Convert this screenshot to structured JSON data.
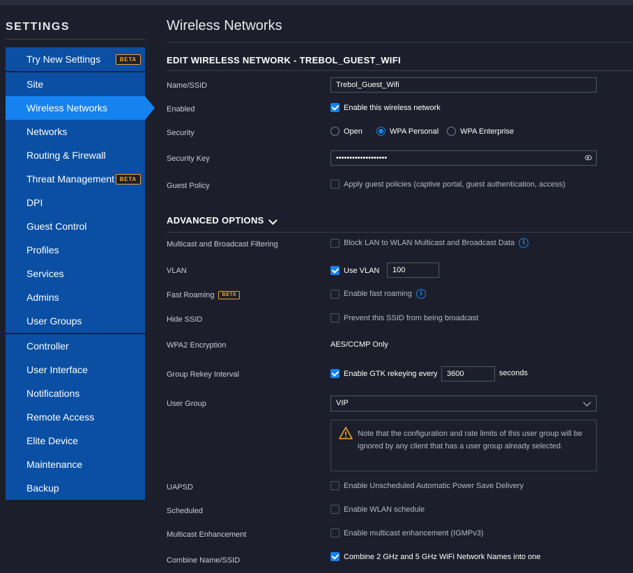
{
  "sidebar": {
    "title": "SETTINGS",
    "beta_label": "BETA",
    "items": [
      {
        "label": "Try New Settings"
      },
      {
        "label": "Site"
      },
      {
        "label": "Wireless Networks"
      },
      {
        "label": "Networks"
      },
      {
        "label": "Routing & Firewall"
      },
      {
        "label": "Threat Management"
      },
      {
        "label": "DPI"
      },
      {
        "label": "Guest Control"
      },
      {
        "label": "Profiles"
      },
      {
        "label": "Services"
      },
      {
        "label": "Admins"
      },
      {
        "label": "User Groups"
      },
      {
        "label": "Controller"
      },
      {
        "label": "User Interface"
      },
      {
        "label": "Notifications"
      },
      {
        "label": "Remote Access"
      },
      {
        "label": "Elite Device"
      },
      {
        "label": "Maintenance"
      },
      {
        "label": "Backup"
      }
    ]
  },
  "main": {
    "page_title": "Wireless Networks",
    "edit_title": "EDIT WIRELESS NETWORK - TREBOL_GUEST_WIFI",
    "ssid": {
      "label": "Name/SSID",
      "value": "Trebol_Guest_Wifi"
    },
    "enabled": {
      "label": "Enabled",
      "option": "Enable this wireless network",
      "checked": true
    },
    "security": {
      "label": "Security",
      "options": [
        "Open",
        "WPA Personal",
        "WPA Enterprise"
      ],
      "selected": "WPA Personal"
    },
    "security_key": {
      "label": "Security Key",
      "value": "•••••••••••••••••••"
    },
    "guest_policy": {
      "label": "Guest Policy",
      "option": "Apply guest policies (captive portal, guest authentication, access)",
      "checked": false
    },
    "advanced_title": "ADVANCED OPTIONS",
    "multicast_filter": {
      "label": "Multicast and Broadcast Filtering",
      "option": "Block LAN to WLAN Multicast and Broadcast Data",
      "checked": false
    },
    "vlan": {
      "label": "VLAN",
      "option": "Use VLAN",
      "checked": true,
      "value": "100"
    },
    "fast_roaming": {
      "label": "Fast Roaming",
      "badge": "BETA",
      "option": "Enable fast roaming",
      "checked": false
    },
    "hide_ssid": {
      "label": "Hide SSID",
      "option": "Prevent this SSID from being broadcast",
      "checked": false
    },
    "wpa2": {
      "label": "WPA2 Encryption",
      "value": "AES/CCMP Only"
    },
    "group_rekey": {
      "label": "Group Rekey Interval",
      "option": "Enable GTK rekeying every",
      "checked": true,
      "value": "3600",
      "unit": "seconds"
    },
    "user_group": {
      "label": "User Group",
      "value": "VIP"
    },
    "note": "Note that the configuration and rate limits of this user group will be ignored by any client that has a user group already selected.",
    "uapsd": {
      "label": "UAPSD",
      "option": "Enable Unscheduled Automatic Power Save Delivery",
      "checked": false
    },
    "scheduled": {
      "label": "Scheduled",
      "option": "Enable WLAN schedule",
      "checked": false
    },
    "multicast_enh": {
      "label": "Multicast Enhancement",
      "option": "Enable multicast enhancement (IGMPv3)",
      "checked": false
    },
    "combine": {
      "label": "Combine Name/SSID",
      "option": "Combine 2 GHz and 5 GHz WiFi Network Names into one",
      "checked": true
    }
  },
  "colors": {
    "accent": "#1582f0",
    "nav_bg": "#0a4fa3",
    "background": "#1c1f2b",
    "warning": "#f0a330"
  }
}
